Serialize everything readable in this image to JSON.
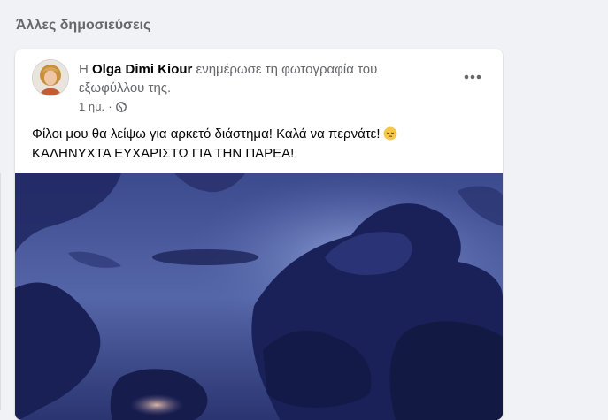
{
  "section": {
    "title": "Άλλες δημοσιεύσεις"
  },
  "post": {
    "prefix": "Η",
    "author": "Olga Dimi Kiour",
    "action": "ενημέρωσε τη φωτογραφία του εξωφύλλου της.",
    "time": "1 ημ.",
    "separator": "·",
    "audience_icon": "globe-icon",
    "more_icon": "more-options-icon",
    "text_line1": "Φίλοι μου θα λείψω για αρκετό διάστημα! Καλά να περνάτε!",
    "text_emoji": "pensive-face-emoji",
    "text_line2": "ΚΑΛΗΝΥΧΤΑ ΕΥΧΑΡΙΣΤΩ ΓΙΑ ΤΗΝ ΠΑΡΕΑ!",
    "photo_subject": "cover-photo-stormy-blue-clouds"
  },
  "colors": {
    "page_bg": "#f0f2f5",
    "card_bg": "#ffffff",
    "secondary_text": "#65676b",
    "primary_text": "#050505",
    "sky_dark": "#1d2457",
    "sky_mid": "#4f5d9e"
  }
}
